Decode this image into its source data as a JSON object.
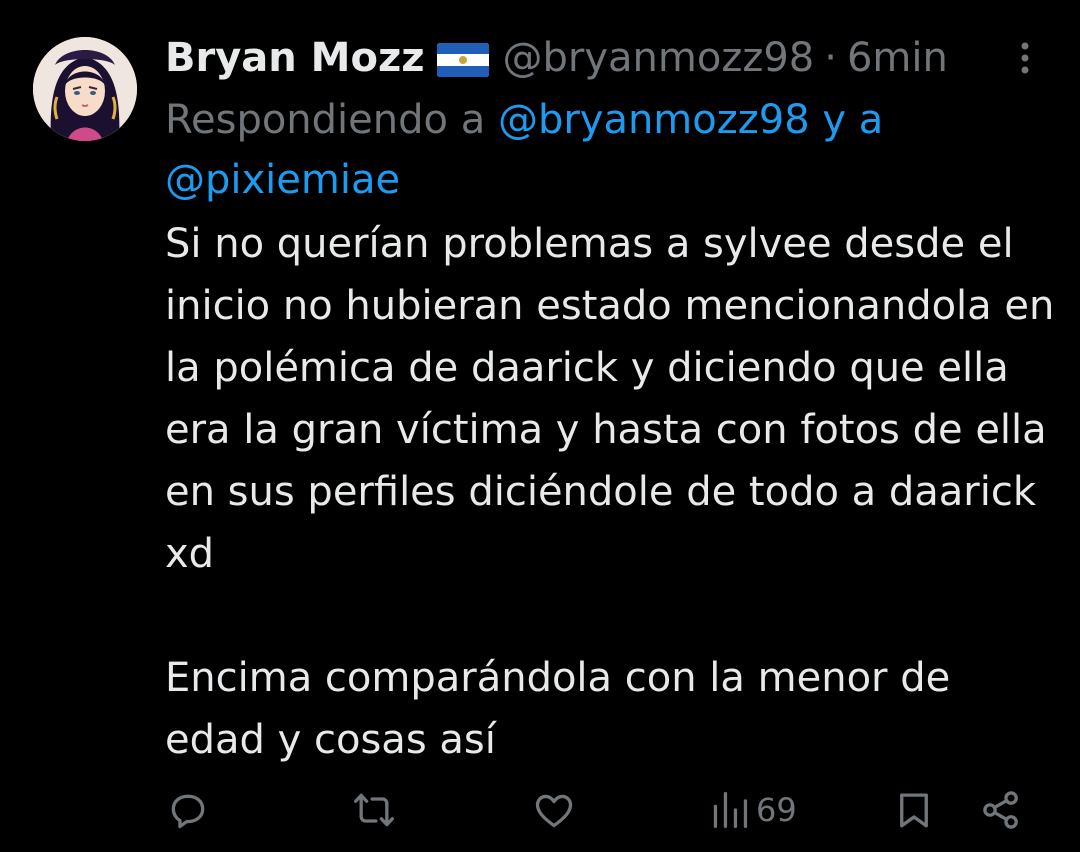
{
  "tweet": {
    "author_name": "Bryan Mozz",
    "handle": "@bryanmozz98",
    "separator": "·",
    "time": "6min",
    "flag_icon": "el-salvador-flag",
    "replying_prefix": "Respondiendo a",
    "replying_to_1": "@bryanmozz98",
    "replying_conjunction": "y a",
    "replying_to_2": "@pixiemiae",
    "paragraph_1": "Si no querían problemas a sylvee desde el inicio no hubieran estado mencionandola en la polémica de daarick y diciendo que ella era la gran víctima y hasta con fotos de ella en sus perfiles diciéndole de todo a daarick xd",
    "paragraph_2": "Encima comparándola con la menor de edad y cosas así"
  },
  "actions": {
    "reply_icon": "reply-icon",
    "retweet_icon": "retweet-icon",
    "like_icon": "heart-icon",
    "views_icon": "views-icon",
    "views_count": "69",
    "bookmark_icon": "bookmark-icon",
    "share_icon": "share-icon"
  },
  "colors": {
    "background": "#000000",
    "primary_text": "#e7e9ea",
    "secondary_text": "#71767b",
    "accent": "#1d9bf0"
  }
}
